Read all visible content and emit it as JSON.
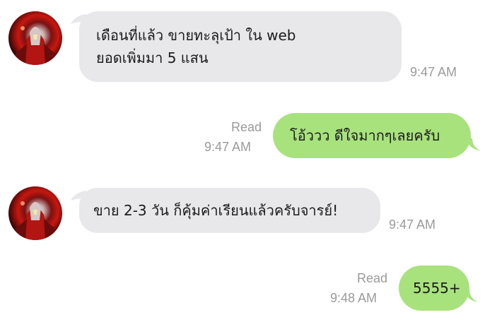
{
  "messages": [
    {
      "direction": "incoming",
      "lines": [
        "เดือนที่แล้ว ขายทะลุเป้า ใน web",
        "ยอดเพิ่มมา 5 แสน"
      ],
      "time": "9:47 AM"
    },
    {
      "direction": "outgoing",
      "lines": [
        "โอ้ววว ดีใจมากๆเลยครับ"
      ],
      "status": "Read",
      "time": "9:47 AM"
    },
    {
      "direction": "incoming",
      "lines": [
        "ขาย 2-3 วัน ก็คุ้มค่าเรียนแล้วครับจารย์!"
      ],
      "time": "9:47 AM"
    },
    {
      "direction": "outgoing",
      "lines": [
        "5555+"
      ],
      "status": "Read",
      "time": "9:48 AM"
    }
  ],
  "colors": {
    "incoming_bubble": "#e8e8eb",
    "outgoing_bubble": "#a8e27d",
    "meta_text": "#9a9a9a"
  },
  "icons": {
    "avatar": "hero-avatar-icon"
  }
}
